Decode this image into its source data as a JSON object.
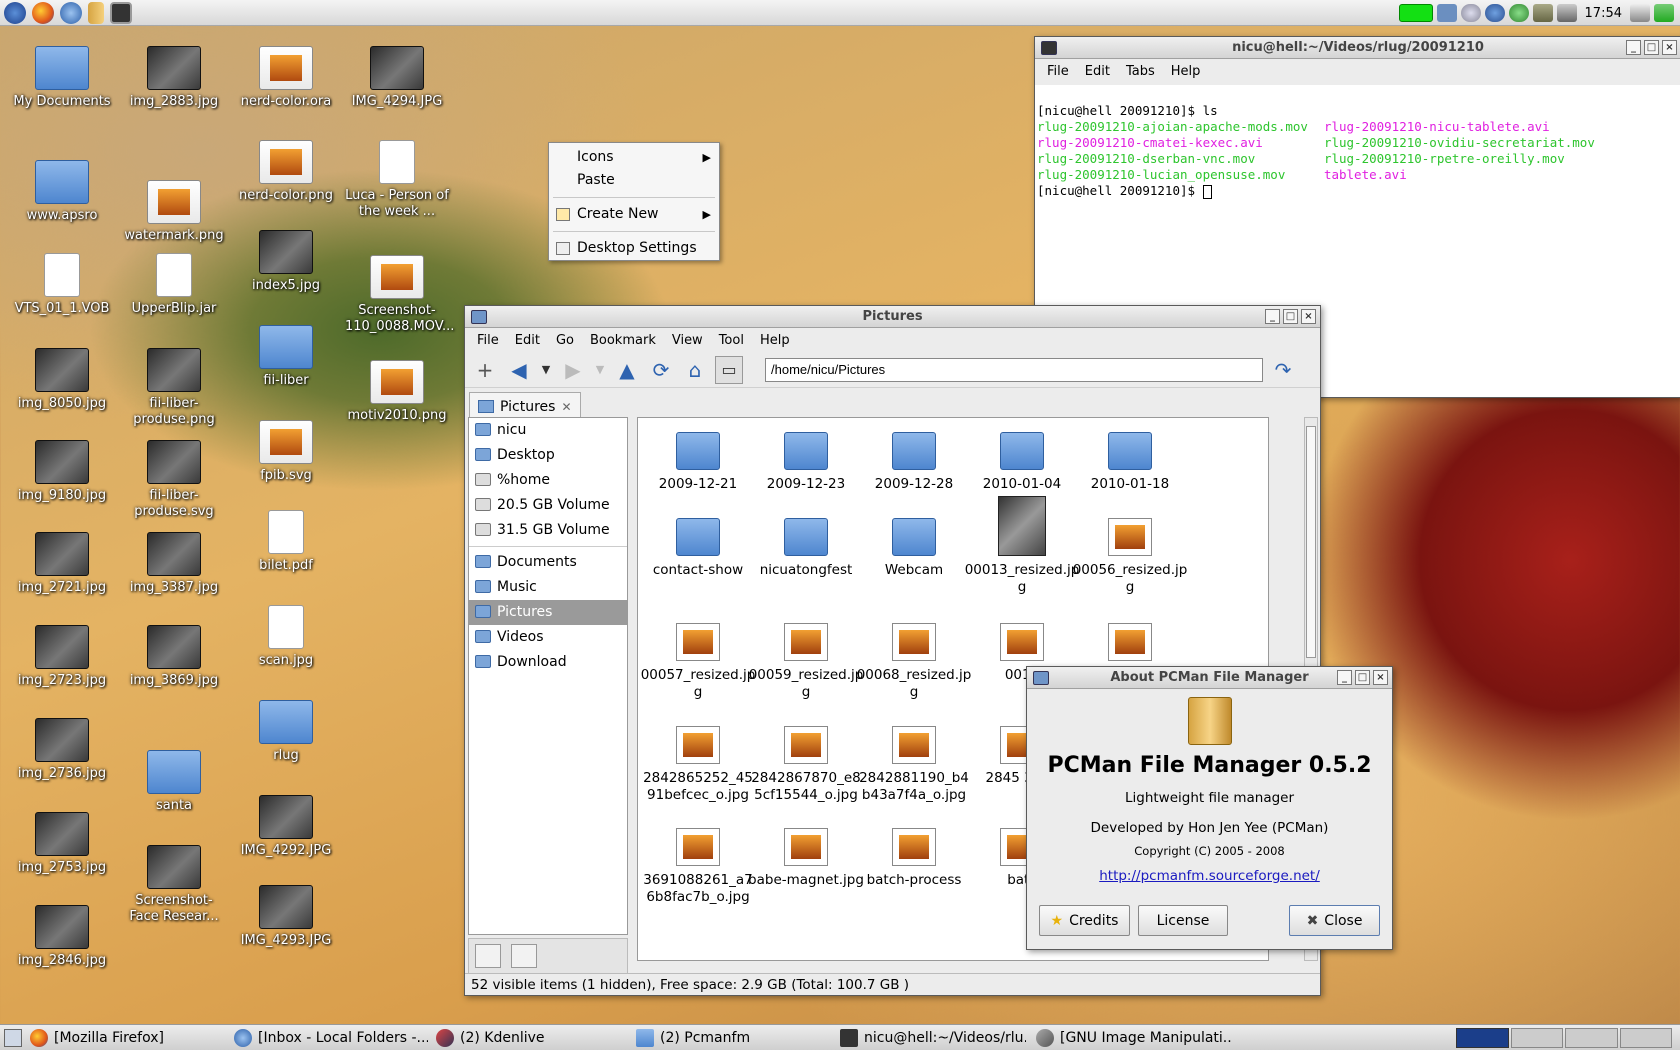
{
  "top_panel": {
    "launchers": [
      "fedora-icon",
      "firefox-icon",
      "thunderbird-icon",
      "file-manager-icon",
      "terminal-icon"
    ],
    "clock": "17:54"
  },
  "desktop_icons": [
    {
      "label": "My Documents",
      "kind": "folder"
    },
    {
      "label": "www.apsro",
      "kind": "folder"
    },
    {
      "label": "VTS_01_1.VOB",
      "kind": "doc"
    },
    {
      "label": "img_8050.jpg",
      "kind": "photo"
    },
    {
      "label": "img_9180.jpg",
      "kind": "photo"
    },
    {
      "label": "img_2721.jpg",
      "kind": "photo"
    },
    {
      "label": "img_2723.jpg",
      "kind": "photo"
    },
    {
      "label": "img_2736.jpg",
      "kind": "photo"
    },
    {
      "label": "img_2753.jpg",
      "kind": "photo"
    },
    {
      "label": "img_2846.jpg",
      "kind": "photo"
    },
    {
      "label": "img_2883.jpg",
      "kind": "photo"
    },
    {
      "label": "watermark.png",
      "kind": "img"
    },
    {
      "label": "UpperBlip.jar",
      "kind": "doc"
    },
    {
      "label": "fii-liber-produse.png",
      "kind": "photo"
    },
    {
      "label": "fii-liber-produse.svg",
      "kind": "photo"
    },
    {
      "label": "img_3387.jpg",
      "kind": "photo"
    },
    {
      "label": "img_3869.jpg",
      "kind": "photo"
    },
    {
      "label": "santa",
      "kind": "folder"
    },
    {
      "label": "Screenshot-Face Resear...",
      "kind": "photo"
    },
    {
      "label": "nerd-color.ora",
      "kind": "img"
    },
    {
      "label": "nerd-color.png",
      "kind": "img"
    },
    {
      "label": "index5.jpg",
      "kind": "photo"
    },
    {
      "label": "fii-liber",
      "kind": "folder"
    },
    {
      "label": "fpib.svg",
      "kind": "img"
    },
    {
      "label": "bilet.pdf",
      "kind": "doc"
    },
    {
      "label": "scan.jpg",
      "kind": "doc"
    },
    {
      "label": "rlug",
      "kind": "folder"
    },
    {
      "label": "IMG_4292.JPG",
      "kind": "photo"
    },
    {
      "label": "IMG_4293.JPG",
      "kind": "photo"
    },
    {
      "label": "IMG_4294.JPG",
      "kind": "photo"
    },
    {
      "label": "Luca - Person of the week ...",
      "kind": "doc"
    },
    {
      "label": "Screenshot-110_0088.MOV...",
      "kind": "img"
    },
    {
      "label": "motiv2010.png",
      "kind": "img"
    }
  ],
  "context_menu": {
    "items": [
      {
        "label": "Icons",
        "submenu": true,
        "icon": false
      },
      {
        "label": "Paste",
        "submenu": false,
        "icon": false
      },
      {
        "label": "Create New",
        "submenu": true,
        "icon": true
      },
      {
        "label": "Desktop Settings",
        "submenu": false,
        "icon": true
      }
    ]
  },
  "terminal": {
    "title": "nicu@hell:~/Videos/rlug/20091210",
    "menu": [
      "File",
      "Edit",
      "Tabs",
      "Help"
    ],
    "prompt1": "[nicu@hell 20091210]$ ls",
    "files_col1": [
      {
        "name": "rlug-20091210-ajoian-apache-mods.mov",
        "color": "green"
      },
      {
        "name": "rlug-20091210-cmatei-kexec.avi",
        "color": "magenta"
      },
      {
        "name": "rlug-20091210-dserban-vnc.mov",
        "color": "green"
      },
      {
        "name": "rlug-20091210-lucian_opensuse.mov",
        "color": "green"
      }
    ],
    "files_col2": [
      {
        "name": "rlug-20091210-nicu-tablete.avi",
        "color": "magenta"
      },
      {
        "name": "rlug-20091210-ovidiu-secretariat.mov",
        "color": "green"
      },
      {
        "name": "rlug-20091210-rpetre-oreilly.mov",
        "color": "green"
      },
      {
        "name": "tablete.avi",
        "color": "magenta"
      }
    ],
    "prompt2": "[nicu@hell 20091210]$ "
  },
  "file_manager": {
    "title": "Pictures",
    "menu": [
      "File",
      "Edit",
      "Go",
      "Bookmark",
      "View",
      "Tool",
      "Help"
    ],
    "address": "/home/nicu/Pictures",
    "tab_label": "Pictures",
    "side_places": [
      "nicu",
      "Desktop",
      "%home",
      "20.5 GB Volume",
      "31.5 GB Volume"
    ],
    "side_bookmarks": [
      "Documents",
      "Music",
      "Pictures",
      "Videos",
      "Download"
    ],
    "selected_bookmark": "Pictures",
    "items": [
      {
        "label": "2009-12-21",
        "kind": "folder"
      },
      {
        "label": "2009-12-23",
        "kind": "folder"
      },
      {
        "label": "2009-12-28",
        "kind": "folder"
      },
      {
        "label": "2010-01-04",
        "kind": "folder"
      },
      {
        "label": "2010-01-18",
        "kind": "folder"
      },
      {
        "label": "contact-show",
        "kind": "folder"
      },
      {
        "label": "nicuatongfest",
        "kind": "folder"
      },
      {
        "label": "Webcam",
        "kind": "folder"
      },
      {
        "label": "00013_resized.jpg",
        "kind": "photo"
      },
      {
        "label": "00056_resized.jpg",
        "kind": "img"
      },
      {
        "label": "00057_resized.jpg",
        "kind": "img"
      },
      {
        "label": "00059_resized.jpg",
        "kind": "img"
      },
      {
        "label": "00068_resized.jpg",
        "kind": "img"
      },
      {
        "label": "0018",
        "kind": "img"
      },
      {
        "label": "",
        "kind": "img"
      },
      {
        "label": "2842865252_4591befcec_o.jpg",
        "kind": "img"
      },
      {
        "label": "2842867870_e85cf15544_o.jpg",
        "kind": "img"
      },
      {
        "label": "2842881190_b4b43a7f4a_o.jpg",
        "kind": "img"
      },
      {
        "label": "2845 3509",
        "kind": "img"
      },
      {
        "label": "",
        "kind": "img"
      },
      {
        "label": "3691088261_a76b8fac7b_o.jpg",
        "kind": "img"
      },
      {
        "label": "babe-magnet.jpg",
        "kind": "img"
      },
      {
        "label": "batch-process",
        "kind": "img"
      },
      {
        "label": "batc",
        "kind": "img"
      }
    ],
    "status": "52 visible items (1 hidden), Free space: 2.9 GB (Total: 100.7 GB )"
  },
  "about": {
    "title": "About PCMan File Manager",
    "name": "PCMan File Manager 0.5.2",
    "subtitle": "Lightweight file manager",
    "developed": "Developed by Hon Jen Yee (PCMan)",
    "copyright": "Copyright (C) 2005 - 2008",
    "link": "http://pcmanfm.sourceforge.net/",
    "credits": "Credits",
    "license": "License",
    "close": "Close"
  },
  "taskbar": {
    "tasks": [
      "[Mozilla Firefox]",
      "[Inbox - Local Folders -...",
      "(2) Kdenlive",
      "(2) Pcmanfm",
      "nicu@hell:~/Videos/rlu...",
      "[GNU Image Manipulati..."
    ]
  },
  "colors": {
    "terminal_green": "#2ec52e",
    "terminal_magenta": "#e020e0",
    "link": "#1a1ac0",
    "selected": "#9a9a9a"
  }
}
